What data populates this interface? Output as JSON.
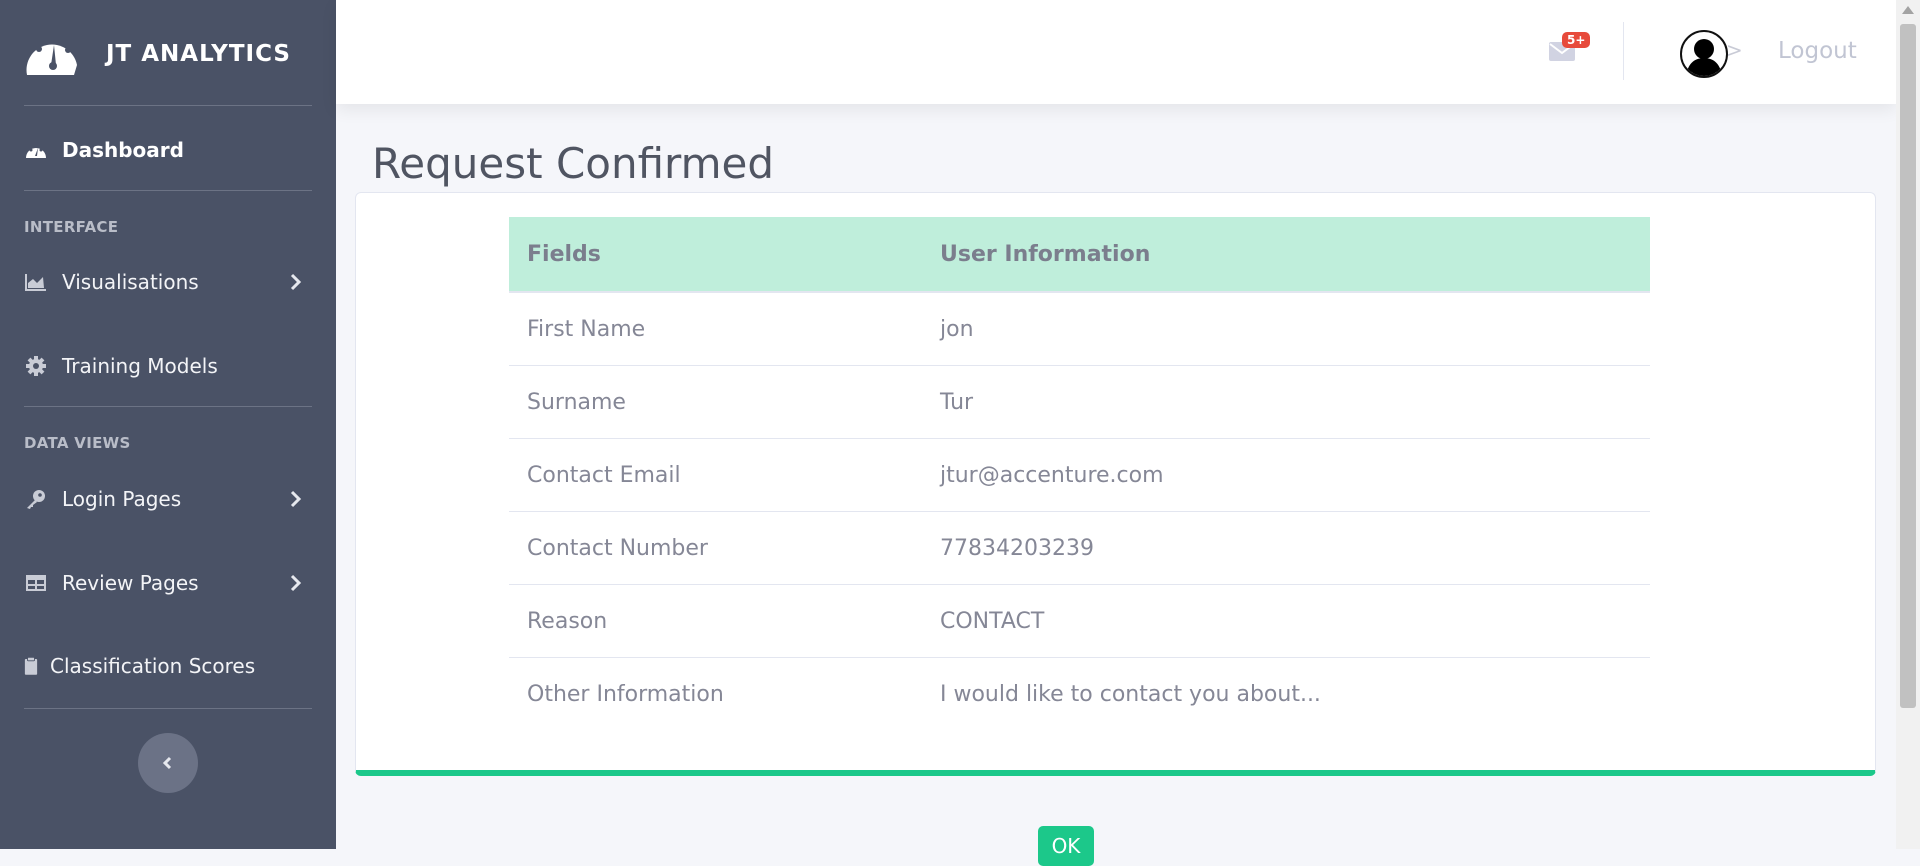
{
  "brand": {
    "title": "JT ANALYTICS"
  },
  "sidebar": {
    "dashboard": {
      "label": "Dashboard",
      "icon": "tachometer-icon"
    },
    "section_interface": "INTERFACE",
    "visualisations": {
      "label": "Visualisations",
      "icon": "area-chart-icon"
    },
    "training_models": {
      "label": "Training Models",
      "icon": "gear-icon"
    },
    "section_data_views": "DATA VIEWS",
    "login_pages": {
      "label": "Login Pages",
      "icon": "key-icon"
    },
    "review_pages": {
      "label": "Review Pages",
      "icon": "table-icon"
    },
    "classification_scores": {
      "label": "Classification Scores",
      "icon": "clipboard-icon"
    }
  },
  "topbar": {
    "badge": "5+",
    "avatar_suffix": ">",
    "logout": "Logout"
  },
  "main": {
    "title": "Request Confirmed",
    "table": {
      "headers": [
        "Fields",
        "User Information"
      ],
      "rows": [
        [
          "First Name",
          "jon"
        ],
        [
          "Surname",
          "Tur"
        ],
        [
          "Contact Email",
          "jtur@accenture.com"
        ],
        [
          "Contact Number",
          "77834203239"
        ],
        [
          "Reason",
          "CONTACT"
        ],
        [
          "Other Information",
          "I would like to contact you about..."
        ]
      ]
    },
    "ok_label": "OK"
  },
  "colors": {
    "sidebar_bg": "#4a5266",
    "accent": "#1cc88a",
    "table_header_bg": "#bfeedb",
    "badge": "#e74a3b"
  }
}
